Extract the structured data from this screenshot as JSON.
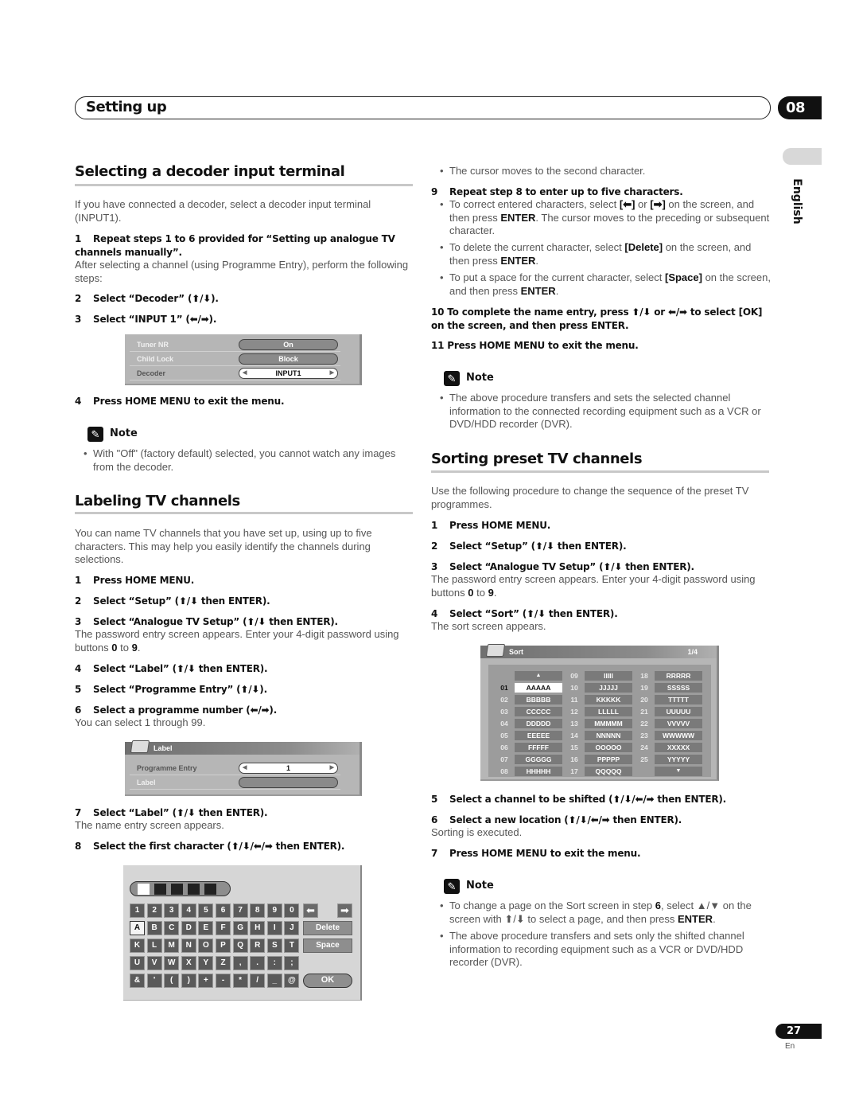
{
  "header": {
    "title": "Setting up",
    "chapter": "08",
    "language_tab": "English"
  },
  "footer": {
    "page_number": "27",
    "language": "En"
  },
  "decoder_section": {
    "title": "Selecting a decoder input terminal",
    "intro": "If you have connected a decoder, select a decoder input terminal (INPUT1).",
    "step1_num": "1",
    "step1": "Repeat steps 1 to 6 provided for “Setting up analogue TV channels manually”.",
    "step1_detail": "After selecting a channel (using Programme Entry), perform the following steps:",
    "step2_num": "2",
    "step2": "Select “Decoder” (⬆/⬇).",
    "step3_num": "3",
    "step3": "Select “INPUT 1” (⬅/➡).",
    "osd": {
      "rows": [
        {
          "label": "Tuner NR",
          "value": "On"
        },
        {
          "label": "Child Lock",
          "value": "Block"
        },
        {
          "label": "Decoder",
          "value": "INPUT1"
        }
      ]
    },
    "step4_num": "4",
    "step4": "Press HOME MENU to exit the menu.",
    "note_label": "Note",
    "note_bullet": "With \"Off\" (factory default) selected, you cannot watch any images from the decoder."
  },
  "labeling_section": {
    "title": "Labeling TV channels",
    "intro": "You can name TV channels that you have set up, using up to five characters. This may help you easily identify the channels during selections.",
    "steps": [
      {
        "num": "1",
        "text": "Press HOME MENU."
      },
      {
        "num": "2",
        "text": "Select “Setup” (⬆/⬇ then ENTER)."
      },
      {
        "num": "3",
        "text": "Select “Analogue TV Setup” (⬆/⬇ then ENTER)."
      },
      {
        "num": "4",
        "text": "Select “Label” (⬆/⬇ then ENTER)."
      },
      {
        "num": "5",
        "text": "Select “Programme Entry” (⬆/⬇)."
      },
      {
        "num": "6",
        "text": "Select a programme number (⬅/➡)."
      },
      {
        "num": "7",
        "text": "Select “Label” (⬆/⬇ then ENTER)."
      },
      {
        "num": "8",
        "text": "Select the first character (⬆/⬇/⬅/➡ then ENTER)."
      }
    ],
    "step3_detail_pre": "The password entry screen appears. Enter your 4-digit password using buttons ",
    "step3_detail_b1": "0",
    "step3_detail_mid": " to ",
    "step3_detail_b2": "9",
    "step3_detail_end": ".",
    "step6_detail": "You can select 1 through 99.",
    "label_osd": {
      "title": "Label",
      "rows": [
        {
          "label": "Programme Entry",
          "value": "1"
        },
        {
          "label": "Label",
          "value": ""
        }
      ]
    },
    "step7_detail": "The name entry screen appears.",
    "keyboard": {
      "rows": [
        [
          "1",
          "2",
          "3",
          "4",
          "5",
          "6",
          "7",
          "8",
          "9",
          "0"
        ],
        [
          "A",
          "B",
          "C",
          "D",
          "E",
          "F",
          "G",
          "H",
          "I",
          "J"
        ],
        [
          "K",
          "L",
          "M",
          "N",
          "O",
          "P",
          "Q",
          "R",
          "S",
          "T"
        ],
        [
          "U",
          "V",
          "W",
          "X",
          "Y",
          "Z",
          ",",
          ".",
          ":",
          ";"
        ],
        [
          "&",
          "'",
          "(",
          ")",
          "+",
          "-",
          "*",
          "/",
          "_",
          "@"
        ]
      ],
      "left_arrow": "⬅",
      "right_arrow": "➡",
      "delete": "Delete",
      "space": "Space",
      "ok": "OK"
    },
    "cont_bullet0": "The cursor moves to the second character.",
    "step9_num": "9",
    "step9": "Repeat step 8 to enter up to five characters.",
    "b9_1_a": "To correct entered characters, select ",
    "b9_1_b": "[⬅]",
    "b9_1_c": " or ",
    "b9_1_d": "[➡]",
    "b9_1_e": " on the screen, and then press ",
    "b9_1_f": "ENTER",
    "b9_1_g": ". The cursor moves to the preceding or subsequent character.",
    "b9_2_a": "To delete the current character, select ",
    "b9_2_b": "[Delete]",
    "b9_2_c": " on the screen, and then press ",
    "b9_2_d": "ENTER",
    "b9_2_e": ".",
    "b9_3_a": "To put a space for the current character, select ",
    "b9_3_b": "[Space]",
    "b9_3_c": " on the screen, and then press ",
    "b9_3_d": "ENTER",
    "b9_3_e": ".",
    "step10": "10  To complete the name entry, press ⬆/⬇ or ⬅/➡ to select [OK] on the screen, and then press ENTER.",
    "step11": "11  Press HOME MENU to exit the menu.",
    "note_label": "Note",
    "note_bullet": "The above procedure transfers and sets the selected channel information to the connected recording equipment such as a VCR or DVD/HDD recorder (DVR)."
  },
  "sorting_section": {
    "title": "Sorting preset TV channels",
    "intro": "Use the following procedure to change the sequence of the preset TV programmes.",
    "steps": [
      {
        "num": "1",
        "text": "Press HOME MENU."
      },
      {
        "num": "2",
        "text": "Select “Setup” (⬆/⬇ then ENTER)."
      },
      {
        "num": "3",
        "text": "Select “Analogue TV Setup” (⬆/⬇ then ENTER)."
      },
      {
        "num": "4",
        "text": "Select “Sort” (⬆/⬇ then ENTER)."
      },
      {
        "num": "5",
        "text": "Select a channel to be shifted (⬆/⬇/⬅/➡ then ENTER)."
      },
      {
        "num": "6",
        "text": "Select a new location (⬆/⬇/⬅/➡ then ENTER)."
      },
      {
        "num": "7",
        "text": "Press HOME MENU to exit the menu."
      }
    ],
    "step3_detail_pre": "The password entry screen appears. Enter your 4-digit password using buttons ",
    "step3_detail_b1": "0",
    "step3_detail_mid": " to ",
    "step3_detail_b2": "9",
    "step3_detail_end": ".",
    "step4_detail": "The sort screen appears.",
    "step6_detail": "Sorting is executed.",
    "sort_osd": {
      "title": "Sort",
      "page": "1/4",
      "up_arrow": "▲",
      "down_arrow": "▼",
      "columns": [
        [
          {
            "num": "",
            "name": "▲"
          },
          {
            "num": "01",
            "name": "AAAAA"
          },
          {
            "num": "02",
            "name": "BBBBB"
          },
          {
            "num": "03",
            "name": "CCCCC"
          },
          {
            "num": "04",
            "name": "DDDDD"
          },
          {
            "num": "05",
            "name": "EEEEE"
          },
          {
            "num": "06",
            "name": "FFFFF"
          },
          {
            "num": "07",
            "name": "GGGGG"
          },
          {
            "num": "08",
            "name": "HHHHH"
          }
        ],
        [
          {
            "num": "09",
            "name": "IIIII"
          },
          {
            "num": "10",
            "name": "JJJJJ"
          },
          {
            "num": "11",
            "name": "KKKKK"
          },
          {
            "num": "12",
            "name": "LLLLL"
          },
          {
            "num": "13",
            "name": "MMMMM"
          },
          {
            "num": "14",
            "name": "NNNNN"
          },
          {
            "num": "15",
            "name": "OOOOO"
          },
          {
            "num": "16",
            "name": "PPPPP"
          },
          {
            "num": "17",
            "name": "QQQQQ"
          }
        ],
        [
          {
            "num": "18",
            "name": "RRRRR"
          },
          {
            "num": "19",
            "name": "SSSSS"
          },
          {
            "num": "20",
            "name": "TTTTT"
          },
          {
            "num": "21",
            "name": "UUUUU"
          },
          {
            "num": "22",
            "name": "VVVVV"
          },
          {
            "num": "23",
            "name": "WWWWW"
          },
          {
            "num": "24",
            "name": "XXXXX"
          },
          {
            "num": "25",
            "name": "YYYYY"
          },
          {
            "num": "",
            "name": "▼"
          }
        ]
      ],
      "selected": "01"
    },
    "note_label": "Note",
    "n1_a": "To change a page on the Sort screen in step ",
    "n1_b": "6",
    "n1_c": ", select ▲/▼ on the screen with ⬆/⬇ to select a page, and then press ",
    "n1_d": "ENTER",
    "n1_e": ".",
    "n2": "The above procedure transfers and sets only the shifted channel information to recording equipment such as a VCR or DVD/HDD recorder (DVR)."
  }
}
